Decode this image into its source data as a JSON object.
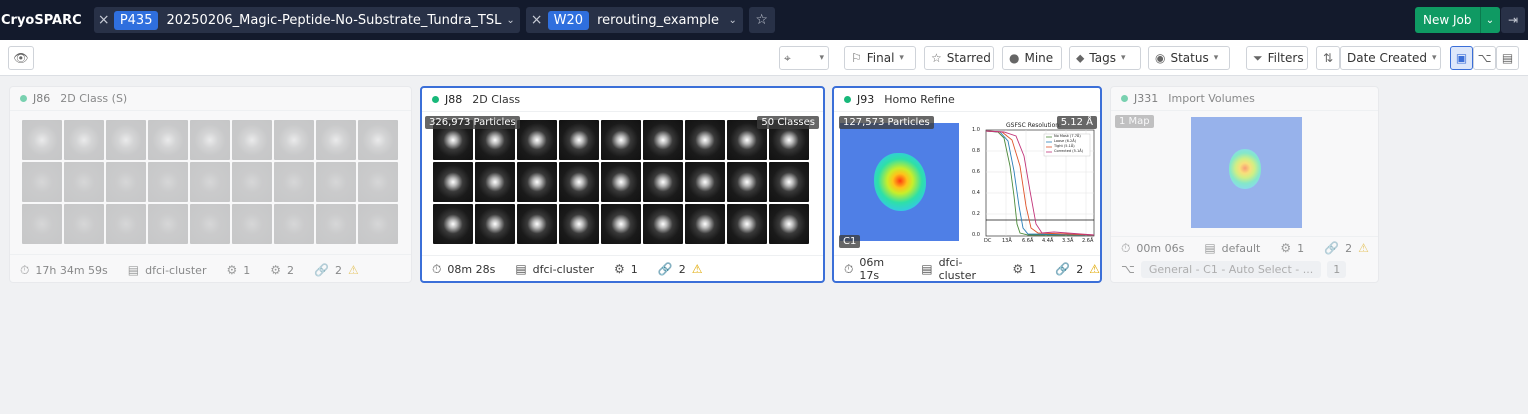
{
  "app": {
    "brand": "CryoSPARC"
  },
  "breadcrumbs": [
    {
      "close": "×",
      "pill": "P435",
      "label": "20250206_Magic-Peptide-No-Substrate_Tundra_TSL",
      "chevron": "⌄"
    },
    {
      "close": "×",
      "pill": "W20",
      "label": "rerouting_example",
      "chevron": "⌄"
    }
  ],
  "header": {
    "star_icon": "star-outline-icon",
    "new_job": "New Job",
    "new_job_chevron": "⌄",
    "exit_icon": "exit-icon"
  },
  "toolbar": {
    "eye_icon": "eye-icon",
    "target_icon": "crosshair-icon",
    "final": "Final",
    "starred": "Starred",
    "mine": "Mine",
    "tags": "Tags",
    "status": "Status",
    "filters": "Filters",
    "sort": "Date Created",
    "views": [
      "card-view-icon",
      "tree-view-icon",
      "table-view-icon"
    ]
  },
  "cards": [
    {
      "id": "J86",
      "type": "2D Class (S)",
      "time": "17h 34m 59s",
      "lane": "dfci-cluster",
      "gpu": "1",
      "cpu": "2",
      "links": "2"
    },
    {
      "id": "J88",
      "type": "2D Class",
      "particles": "326,973 Particles",
      "classes": "50 Classes",
      "time": "08m 28s",
      "lane": "dfci-cluster",
      "gpu": "1",
      "links": "2"
    },
    {
      "id": "J93",
      "type": "Homo Refine",
      "particles": "127,573 Particles",
      "resolution": "5.12 Å",
      "symmetry": "C1",
      "fsc_title": "GSFSC Resolution:",
      "fsc_legend": [
        "No Mask (7.7Å)",
        "Loose (6.2Å)",
        "Tight (5.1Å)",
        "Corrected (5.1Å)"
      ],
      "fsc_yticks": [
        "1.0",
        "0.8",
        "0.6",
        "0.4",
        "0.2",
        "0.0"
      ],
      "fsc_xticks": [
        "DC",
        "13Å",
        "6.6Å",
        "4.4Å",
        "3.3Å",
        "2.6Å"
      ],
      "time": "06m 17s",
      "lane": "dfci-cluster",
      "gpu": "1",
      "links": "2"
    },
    {
      "id": "J331",
      "type": "Import Volumes",
      "maps": "1 Map",
      "time": "00m 06s",
      "lane": "default",
      "gpu": "1",
      "links": "2",
      "output": "General - C1 - Auto Select - ...",
      "output_count": "1"
    }
  ],
  "colors": {
    "topbar": "#131a2c",
    "pill": "#2f6fde",
    "new_job": "#0f9a63",
    "selected_border": "#3b6fd8",
    "status_dot": "#18b87a",
    "warning": "#e0a800"
  }
}
